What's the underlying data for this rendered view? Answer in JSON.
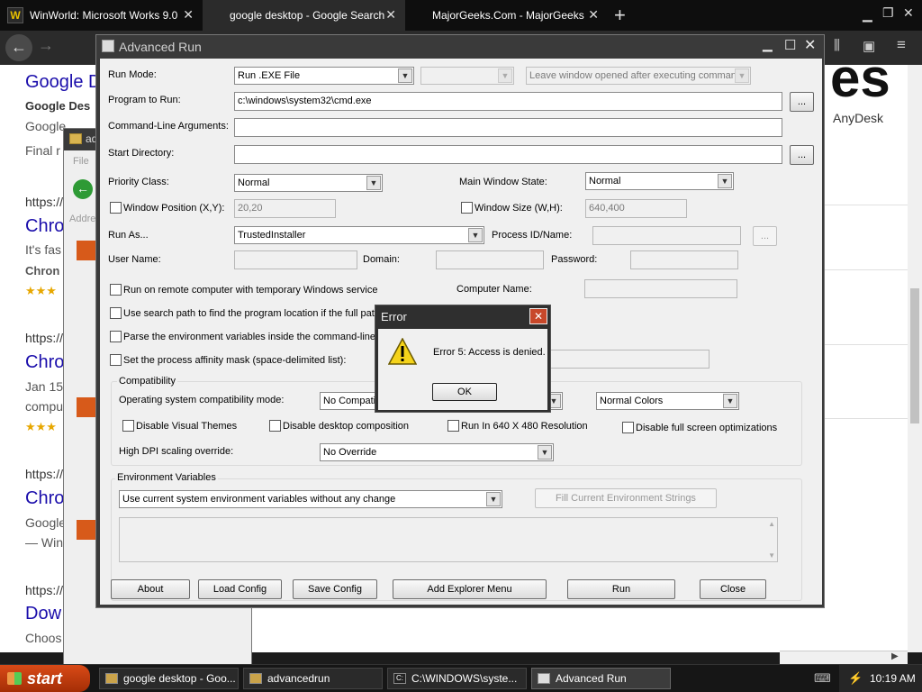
{
  "browser": {
    "tabs": [
      {
        "label": "WinWorld: Microsoft Works 9.0",
        "active": false,
        "favicon": "W"
      },
      {
        "label": "google desktop - Google Search",
        "active": true
      },
      {
        "label": "MajorGeeks.Com - MajorGeeks",
        "active": false
      }
    ],
    "new_tab": "+",
    "results": {
      "heading": "Google D",
      "sub_bold": "Google Des",
      "line1": "Google",
      "line2": "Final r",
      "url1": "https://",
      "title2": "Chro",
      "line3": "It's fas",
      "bold2": "Chron",
      "stars": "★★★",
      "url2": "https://",
      "title3": "Chro",
      "date3": "Jan 15",
      "line4": "compu",
      "stars2": "★★★",
      "url3": "https://",
      "title4": "Chro",
      "line5": "Google",
      "line6": "— Win",
      "url4": "https://",
      "title5": "Dow",
      "line7": "Choos",
      "right_logo": "es",
      "right_label": "AnyDesk"
    }
  },
  "explorer": {
    "title": "ad",
    "menu": "File",
    "address": "Addre"
  },
  "advanced_run": {
    "title": "Advanced Run",
    "run_mode_label": "Run Mode:",
    "run_mode_value": "Run .EXE File",
    "leave_window": "Leave window opened after executing comman",
    "program_label": "Program to Run:",
    "program_value": "c:\\windows\\system32\\cmd.exe",
    "browse": "...",
    "args_label": "Command-Line Arguments:",
    "start_dir_label": "Start Directory:",
    "priority_label": "Priority Class:",
    "priority_value": "Normal",
    "main_state_label": "Main Window State:",
    "main_state_value": "Normal",
    "win_pos_label": "Window Position (X,Y):",
    "win_pos_value": "20,20",
    "win_size_label": "Window Size (W,H):",
    "win_size_value": "640,400",
    "run_as_label": "Run As...",
    "run_as_value": "TrustedInstaller",
    "process_id_label": "Process ID/Name:",
    "user_name_label": "User Name:",
    "domain_label": "Domain:",
    "password_label": "Password:",
    "remote_label": "Run on remote computer with temporary Windows service",
    "computer_name_label": "Computer Name:",
    "search_path_label": "Use search path to find the program location if the full path",
    "parse_env_label": "Parse the environment variables inside the command-line s",
    "affinity_label": "Set the process affinity mask (space-delimited list):",
    "compat_group": "Compatibility",
    "os_compat_label": "Operating system compatibility mode:",
    "os_compat_value": "No Compatib",
    "colors_value": "Normal Colors",
    "disable_themes": "Disable Visual Themes",
    "disable_desktop": "Disable desktop composition",
    "run_640": "Run In 640 X 480 Resolution",
    "disable_fullscreen": "Disable full screen optimizations",
    "dpi_label": "High DPI scaling override:",
    "dpi_value": "No Override",
    "env_group": "Environment Variables",
    "env_value": "Use current system environment variables without any change",
    "fill_env": "Fill Current Environment Strings",
    "buttons": {
      "about": "About",
      "load": "Load Config",
      "save": "Save Config",
      "explorer_menu": "Add Explorer Menu",
      "run": "Run",
      "close": "Close"
    }
  },
  "error_dialog": {
    "title": "Error",
    "message": "Error 5: Access is denied.",
    "ok": "OK",
    "icon": "warning-icon"
  },
  "taskbar": {
    "start": "start",
    "items": [
      {
        "label": "google desktop - Goo...",
        "active": false
      },
      {
        "label": "advancedrun",
        "active": false
      },
      {
        "label": "C:\\WINDOWS\\syste...",
        "active": false
      },
      {
        "label": "Advanced Run",
        "active": true
      }
    ],
    "clock": "10:19 AM"
  }
}
